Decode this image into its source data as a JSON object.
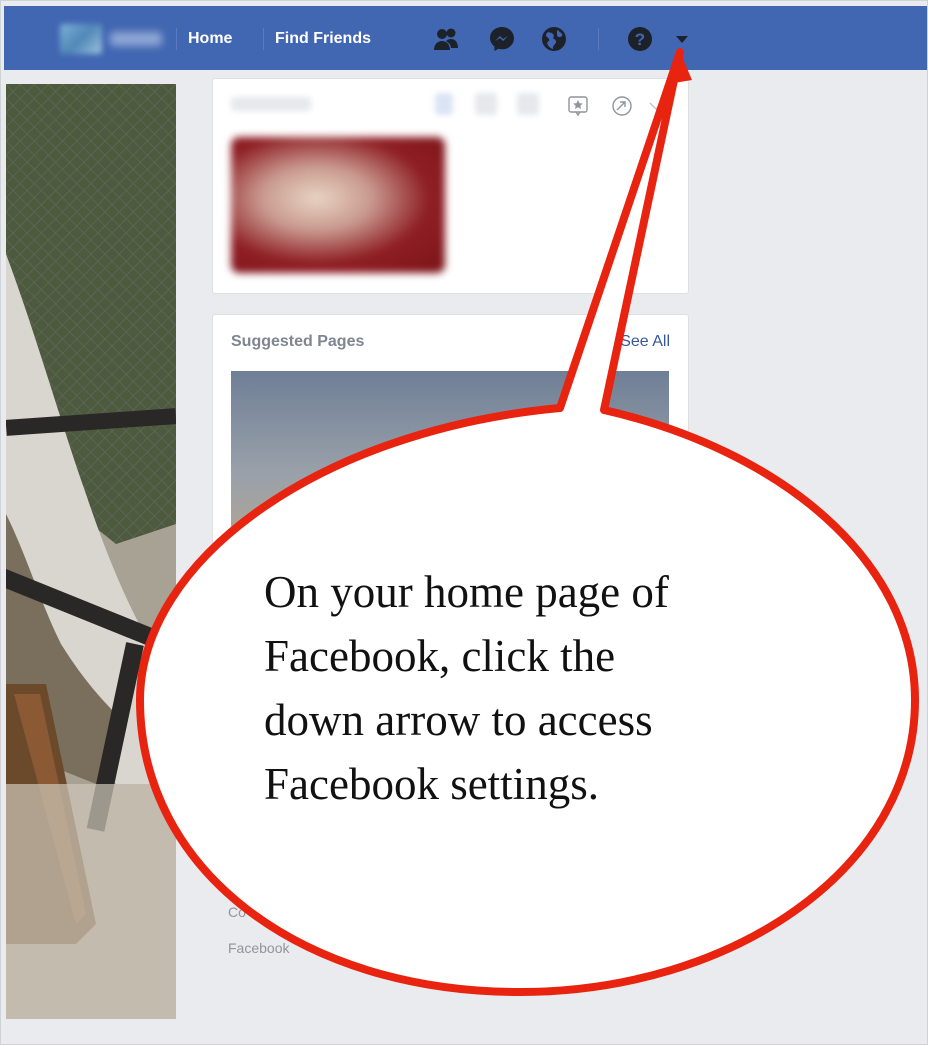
{
  "nav": {
    "home_label": "Home",
    "find_friends_label": "Find Friends",
    "icons": [
      "friend-requests-icon",
      "messenger-icon",
      "notifications-globe-icon",
      "help-icon",
      "dropdown-arrow-icon"
    ]
  },
  "sidebar": {
    "suggested_pages_title": "Suggested Pages",
    "see_all_label": "See All"
  },
  "footer": {
    "line1_fragment": "Co",
    "line2_fragment": "Facebook"
  },
  "callout": {
    "line1": "On your home page of",
    "line2": "Facebook, click the",
    "line3": "down arrow to access",
    "line4": "Facebook settings."
  },
  "colors": {
    "nav_blue": "#4267b2",
    "callout_red": "#e8230f",
    "link_blue": "#365899"
  }
}
